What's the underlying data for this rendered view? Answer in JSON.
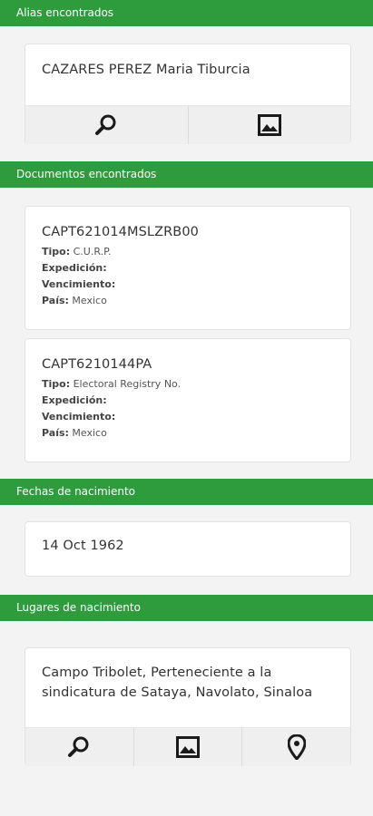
{
  "sections": {
    "alias": {
      "title": "Alias encontrados",
      "items": [
        {
          "name": "CAZARES PEREZ Maria Tiburcia"
        }
      ]
    },
    "documents": {
      "title": "Documentos encontrados",
      "labels": {
        "tipo": "Tipo:",
        "expedicion": "Expedición:",
        "vencimiento": "Vencimiento:",
        "pais": "País:"
      },
      "items": [
        {
          "number": "CAPT621014MSLZRB00",
          "tipo": "C.U.R.P.",
          "expedicion": "",
          "vencimiento": "",
          "pais": "Mexico"
        },
        {
          "number": "CAPT6210144PA",
          "tipo": "Electoral Registry No.",
          "expedicion": "",
          "vencimiento": "",
          "pais": "Mexico"
        }
      ]
    },
    "birth_dates": {
      "title": "Fechas de nacimiento",
      "items": [
        {
          "date": "14 Oct 1962"
        }
      ]
    },
    "birth_places": {
      "title": "Lugares de nacimiento",
      "items": [
        {
          "place": "Campo Tribolet, Perteneciente a la sindicatura de Sataya, Navolato, Sinaloa"
        }
      ]
    }
  },
  "icons": {
    "search": "search-icon",
    "image": "image-icon",
    "map": "map-pin-icon"
  },
  "colors": {
    "header_bg": "#2e9b3c",
    "icon": "#1b1b1b"
  }
}
